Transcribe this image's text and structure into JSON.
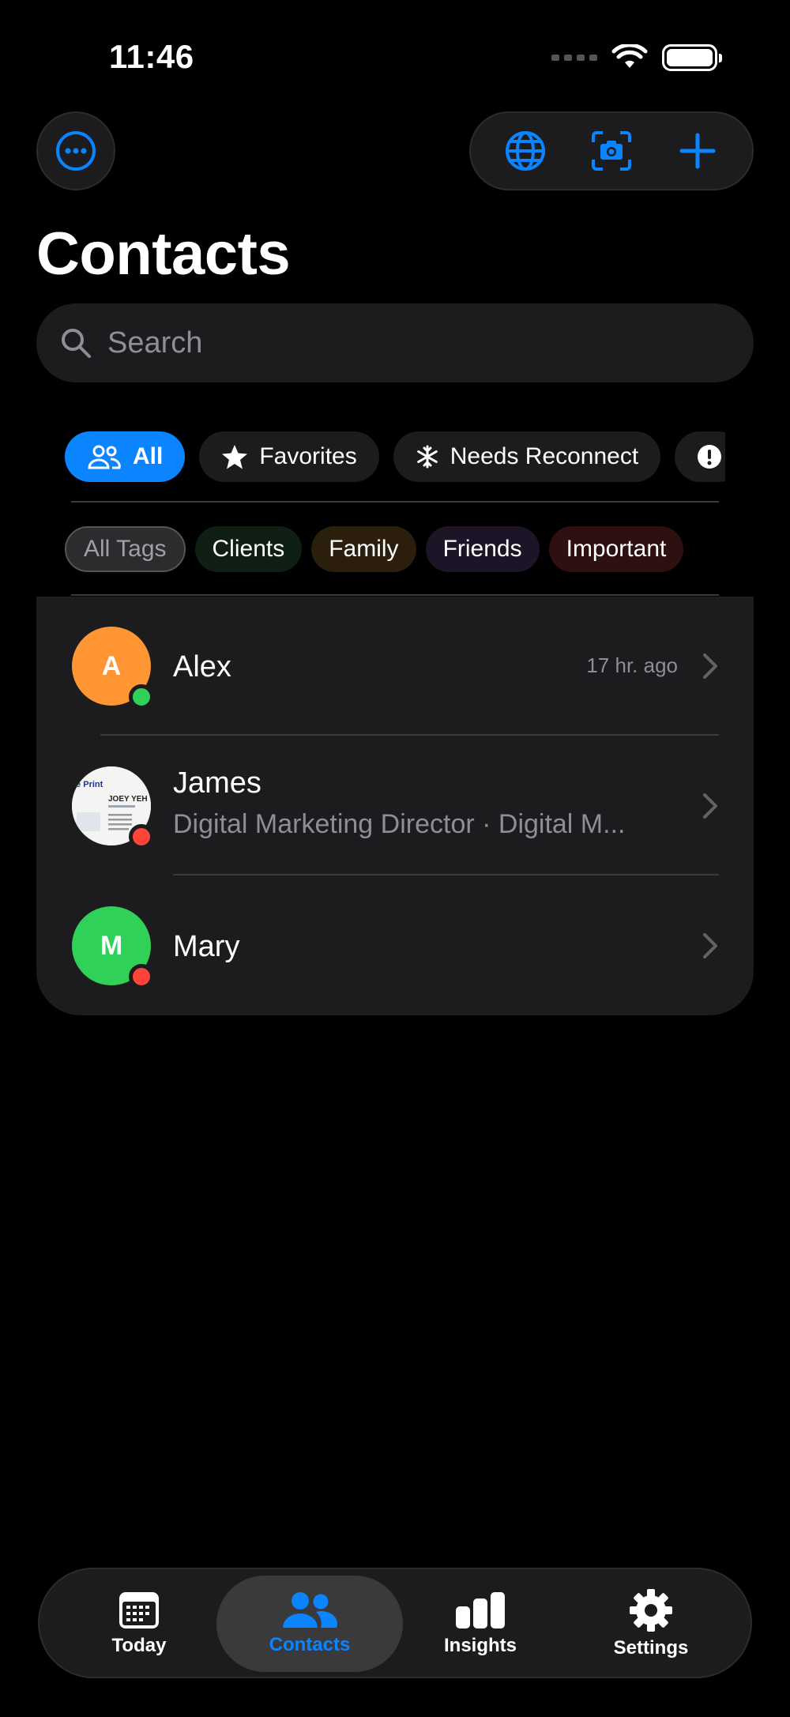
{
  "status_bar": {
    "time": "11:46"
  },
  "header": {
    "title": "Contacts"
  },
  "search": {
    "placeholder": "Search"
  },
  "filters": [
    {
      "label": "All",
      "icon": "people-icon",
      "active": true
    },
    {
      "label": "Favorites",
      "icon": "star-icon",
      "active": false
    },
    {
      "label": "Needs Reconnect",
      "icon": "snowflake-icon",
      "active": false
    },
    {
      "label": "",
      "icon": "exclamation-icon",
      "active": false
    }
  ],
  "tags": [
    {
      "label": "All Tags"
    },
    {
      "label": "Clients"
    },
    {
      "label": "Family"
    },
    {
      "label": "Friends"
    },
    {
      "label": "Important"
    }
  ],
  "contacts": [
    {
      "initial": "A",
      "name": "Alex",
      "subtitle": "",
      "time": "17 hr. ago",
      "avatar_color": "#ff9533",
      "status_color": "#30d158"
    },
    {
      "initial": "",
      "name": "James",
      "subtitle": "Digital Marketing Director · Digital M...",
      "time": "",
      "avatar_color": "#f4f4f2",
      "status_color": "#ff453a",
      "card": {
        "brand": "le Print",
        "person": "JOEY YEH"
      }
    },
    {
      "initial": "M",
      "name": "Mary",
      "subtitle": "",
      "time": "",
      "avatar_color": "#30d158",
      "status_color": "#ff453a"
    }
  ],
  "tabbar": [
    {
      "label": "Today",
      "icon": "calendar-icon",
      "active": false
    },
    {
      "label": "Contacts",
      "icon": "people-icon",
      "active": true
    },
    {
      "label": "Insights",
      "icon": "bar-chart-icon",
      "active": false
    },
    {
      "label": "Settings",
      "icon": "gear-icon",
      "active": false
    }
  ],
  "colors": {
    "accent": "#0a84ff",
    "background": "#000000",
    "surface": "#1c1c1e"
  }
}
